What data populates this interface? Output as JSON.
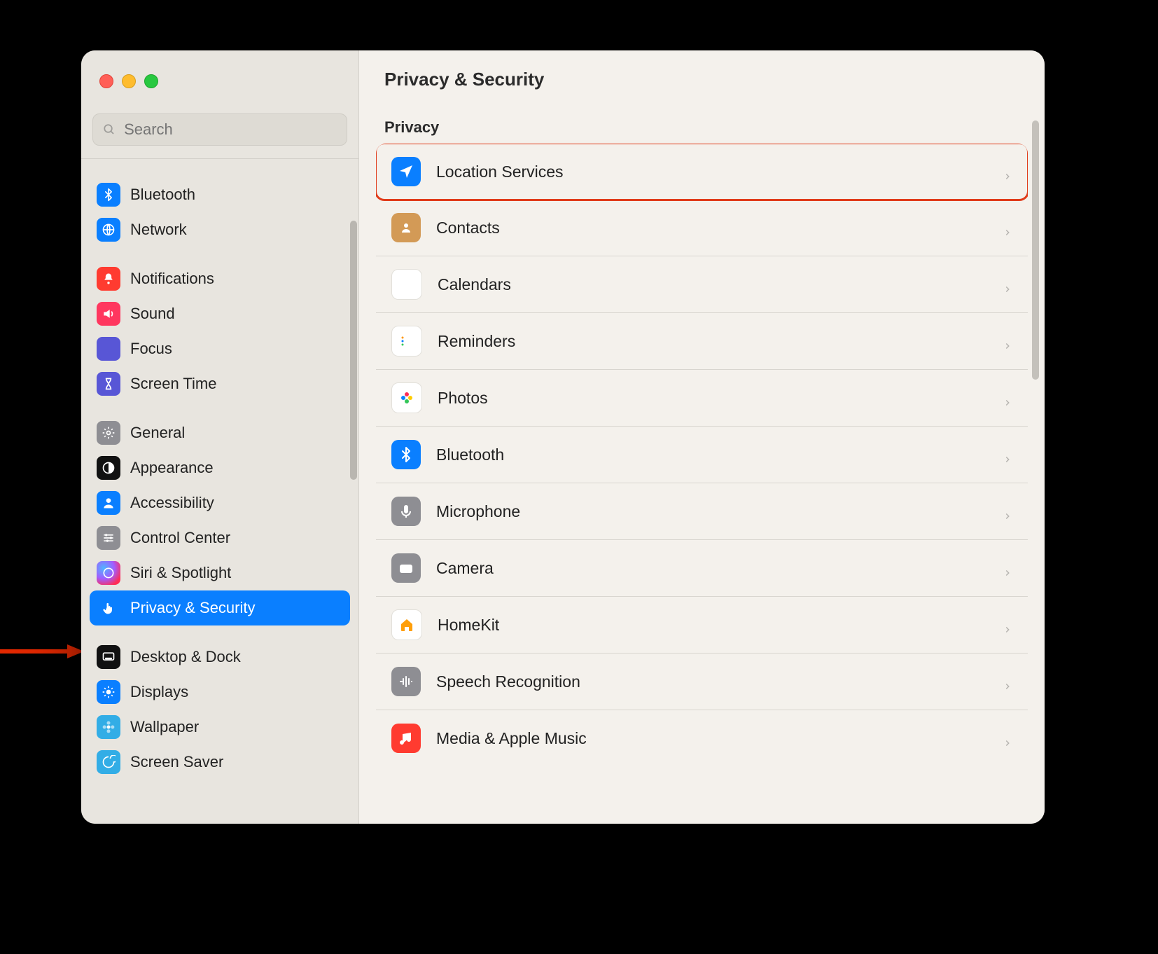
{
  "header": {
    "title": "Privacy & Security"
  },
  "search": {
    "placeholder": "Search"
  },
  "sidebar": {
    "groups": [
      {
        "items": [
          {
            "label": "Bluetooth",
            "icon": "bluetooth-icon",
            "bg": "bg-blue"
          },
          {
            "label": "Network",
            "icon": "globe-icon",
            "bg": "bg-blue"
          }
        ]
      },
      {
        "items": [
          {
            "label": "Notifications",
            "icon": "bell-icon",
            "bg": "bg-red"
          },
          {
            "label": "Sound",
            "icon": "speaker-icon",
            "bg": "bg-pink"
          },
          {
            "label": "Focus",
            "icon": "moon-icon",
            "bg": "bg-purple"
          },
          {
            "label": "Screen Time",
            "icon": "hourglass-icon",
            "bg": "bg-purple"
          }
        ]
      },
      {
        "items": [
          {
            "label": "General",
            "icon": "gear-icon",
            "bg": "bg-grey"
          },
          {
            "label": "Appearance",
            "icon": "contrast-icon",
            "bg": "bg-black"
          },
          {
            "label": "Accessibility",
            "icon": "person-icon",
            "bg": "bg-blue"
          },
          {
            "label": "Control Center",
            "icon": "sliders-icon",
            "bg": "bg-grey"
          },
          {
            "label": "Siri & Spotlight",
            "icon": "siri-icon",
            "bg": "bg-siri"
          },
          {
            "label": "Privacy & Security",
            "icon": "hand-icon",
            "bg": "bg-blue",
            "selected": true
          }
        ]
      },
      {
        "items": [
          {
            "label": "Desktop & Dock",
            "icon": "dock-icon",
            "bg": "bg-black"
          },
          {
            "label": "Displays",
            "icon": "sun-icon",
            "bg": "bg-blue"
          },
          {
            "label": "Wallpaper",
            "icon": "flower-icon",
            "bg": "bg-teal"
          },
          {
            "label": "Screen Saver",
            "icon": "swirl-icon",
            "bg": "bg-teal"
          }
        ]
      }
    ]
  },
  "main": {
    "section": "Privacy",
    "rows": [
      {
        "label": "Location Services",
        "icon": "location-icon",
        "bg": "bg-blue",
        "highlight": true
      },
      {
        "label": "Contacts",
        "icon": "contacts-icon",
        "bg": "bg-orange"
      },
      {
        "label": "Calendars",
        "icon": "calendar-icon",
        "bg": "bg-white",
        "dark": true
      },
      {
        "label": "Reminders",
        "icon": "list-icon",
        "bg": "bg-white",
        "dark": true
      },
      {
        "label": "Photos",
        "icon": "photos-icon",
        "bg": "bg-white",
        "dark": true
      },
      {
        "label": "Bluetooth",
        "icon": "bluetooth-icon",
        "bg": "bg-blue"
      },
      {
        "label": "Microphone",
        "icon": "mic-icon",
        "bg": "bg-grey"
      },
      {
        "label": "Camera",
        "icon": "camera-icon",
        "bg": "bg-grey"
      },
      {
        "label": "HomeKit",
        "icon": "home-icon",
        "bg": "bg-white",
        "dark": true
      },
      {
        "label": "Speech Recognition",
        "icon": "waveform-icon",
        "bg": "bg-grey"
      },
      {
        "label": "Media & Apple Music",
        "icon": "music-icon",
        "bg": "bg-red"
      }
    ]
  }
}
